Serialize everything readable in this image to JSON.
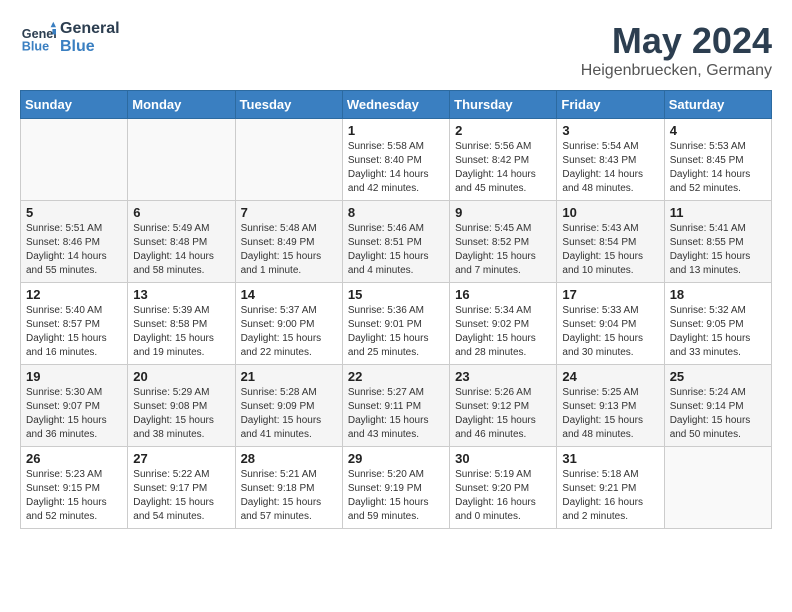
{
  "logo": {
    "line1": "General",
    "line2": "Blue"
  },
  "title": "May 2024",
  "location": "Heigenbruecken, Germany",
  "days_of_week": [
    "Sunday",
    "Monday",
    "Tuesday",
    "Wednesday",
    "Thursday",
    "Friday",
    "Saturday"
  ],
  "weeks": [
    [
      {
        "day": "",
        "info": ""
      },
      {
        "day": "",
        "info": ""
      },
      {
        "day": "",
        "info": ""
      },
      {
        "day": "1",
        "info": "Sunrise: 5:58 AM\nSunset: 8:40 PM\nDaylight: 14 hours\nand 42 minutes."
      },
      {
        "day": "2",
        "info": "Sunrise: 5:56 AM\nSunset: 8:42 PM\nDaylight: 14 hours\nand 45 minutes."
      },
      {
        "day": "3",
        "info": "Sunrise: 5:54 AM\nSunset: 8:43 PM\nDaylight: 14 hours\nand 48 minutes."
      },
      {
        "day": "4",
        "info": "Sunrise: 5:53 AM\nSunset: 8:45 PM\nDaylight: 14 hours\nand 52 minutes."
      }
    ],
    [
      {
        "day": "5",
        "info": "Sunrise: 5:51 AM\nSunset: 8:46 PM\nDaylight: 14 hours\nand 55 minutes."
      },
      {
        "day": "6",
        "info": "Sunrise: 5:49 AM\nSunset: 8:48 PM\nDaylight: 14 hours\nand 58 minutes."
      },
      {
        "day": "7",
        "info": "Sunrise: 5:48 AM\nSunset: 8:49 PM\nDaylight: 15 hours\nand 1 minute."
      },
      {
        "day": "8",
        "info": "Sunrise: 5:46 AM\nSunset: 8:51 PM\nDaylight: 15 hours\nand 4 minutes."
      },
      {
        "day": "9",
        "info": "Sunrise: 5:45 AM\nSunset: 8:52 PM\nDaylight: 15 hours\nand 7 minutes."
      },
      {
        "day": "10",
        "info": "Sunrise: 5:43 AM\nSunset: 8:54 PM\nDaylight: 15 hours\nand 10 minutes."
      },
      {
        "day": "11",
        "info": "Sunrise: 5:41 AM\nSunset: 8:55 PM\nDaylight: 15 hours\nand 13 minutes."
      }
    ],
    [
      {
        "day": "12",
        "info": "Sunrise: 5:40 AM\nSunset: 8:57 PM\nDaylight: 15 hours\nand 16 minutes."
      },
      {
        "day": "13",
        "info": "Sunrise: 5:39 AM\nSunset: 8:58 PM\nDaylight: 15 hours\nand 19 minutes."
      },
      {
        "day": "14",
        "info": "Sunrise: 5:37 AM\nSunset: 9:00 PM\nDaylight: 15 hours\nand 22 minutes."
      },
      {
        "day": "15",
        "info": "Sunrise: 5:36 AM\nSunset: 9:01 PM\nDaylight: 15 hours\nand 25 minutes."
      },
      {
        "day": "16",
        "info": "Sunrise: 5:34 AM\nSunset: 9:02 PM\nDaylight: 15 hours\nand 28 minutes."
      },
      {
        "day": "17",
        "info": "Sunrise: 5:33 AM\nSunset: 9:04 PM\nDaylight: 15 hours\nand 30 minutes."
      },
      {
        "day": "18",
        "info": "Sunrise: 5:32 AM\nSunset: 9:05 PM\nDaylight: 15 hours\nand 33 minutes."
      }
    ],
    [
      {
        "day": "19",
        "info": "Sunrise: 5:30 AM\nSunset: 9:07 PM\nDaylight: 15 hours\nand 36 minutes."
      },
      {
        "day": "20",
        "info": "Sunrise: 5:29 AM\nSunset: 9:08 PM\nDaylight: 15 hours\nand 38 minutes."
      },
      {
        "day": "21",
        "info": "Sunrise: 5:28 AM\nSunset: 9:09 PM\nDaylight: 15 hours\nand 41 minutes."
      },
      {
        "day": "22",
        "info": "Sunrise: 5:27 AM\nSunset: 9:11 PM\nDaylight: 15 hours\nand 43 minutes."
      },
      {
        "day": "23",
        "info": "Sunrise: 5:26 AM\nSunset: 9:12 PM\nDaylight: 15 hours\nand 46 minutes."
      },
      {
        "day": "24",
        "info": "Sunrise: 5:25 AM\nSunset: 9:13 PM\nDaylight: 15 hours\nand 48 minutes."
      },
      {
        "day": "25",
        "info": "Sunrise: 5:24 AM\nSunset: 9:14 PM\nDaylight: 15 hours\nand 50 minutes."
      }
    ],
    [
      {
        "day": "26",
        "info": "Sunrise: 5:23 AM\nSunset: 9:15 PM\nDaylight: 15 hours\nand 52 minutes."
      },
      {
        "day": "27",
        "info": "Sunrise: 5:22 AM\nSunset: 9:17 PM\nDaylight: 15 hours\nand 54 minutes."
      },
      {
        "day": "28",
        "info": "Sunrise: 5:21 AM\nSunset: 9:18 PM\nDaylight: 15 hours\nand 57 minutes."
      },
      {
        "day": "29",
        "info": "Sunrise: 5:20 AM\nSunset: 9:19 PM\nDaylight: 15 hours\nand 59 minutes."
      },
      {
        "day": "30",
        "info": "Sunrise: 5:19 AM\nSunset: 9:20 PM\nDaylight: 16 hours\nand 0 minutes."
      },
      {
        "day": "31",
        "info": "Sunrise: 5:18 AM\nSunset: 9:21 PM\nDaylight: 16 hours\nand 2 minutes."
      },
      {
        "day": "",
        "info": ""
      }
    ]
  ]
}
